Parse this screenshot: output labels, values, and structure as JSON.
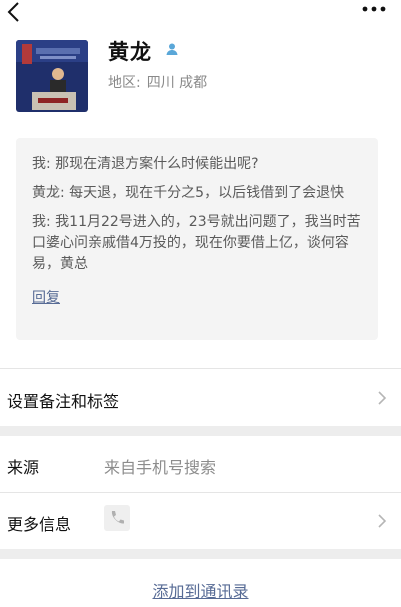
{
  "header": {
    "back_icon": "chevron-left-icon",
    "more_icon": "more-horizontal-icon"
  },
  "profile": {
    "name": "黄龙",
    "gender_icon": "user-badge-icon",
    "region_label": "地区:",
    "region_value": "四川 成都"
  },
  "moment": {
    "messages": [
      "我: 那现在清退方案什么时候能出呢?",
      "黄龙: 每天退，现在千分之5，以后钱借到了会退快",
      "我: 我11月22号进入的，23号就出问题了，我当时苦口婆心问亲戚借4万投的，现在你要借上亿，谈何容易，黄总"
    ],
    "reply_label": "回复"
  },
  "settings": {
    "remark_tags_label": "设置备注和标签",
    "source_label": "来源",
    "source_value": "来自手机号搜索",
    "more_info_label": "更多信息"
  },
  "footer": {
    "add_contact_label": "添加到通讯录"
  },
  "colors": {
    "link": "#576b95",
    "muted": "#8a8a8a",
    "card_bg": "#f4f4f4",
    "separator": "#ededed"
  }
}
